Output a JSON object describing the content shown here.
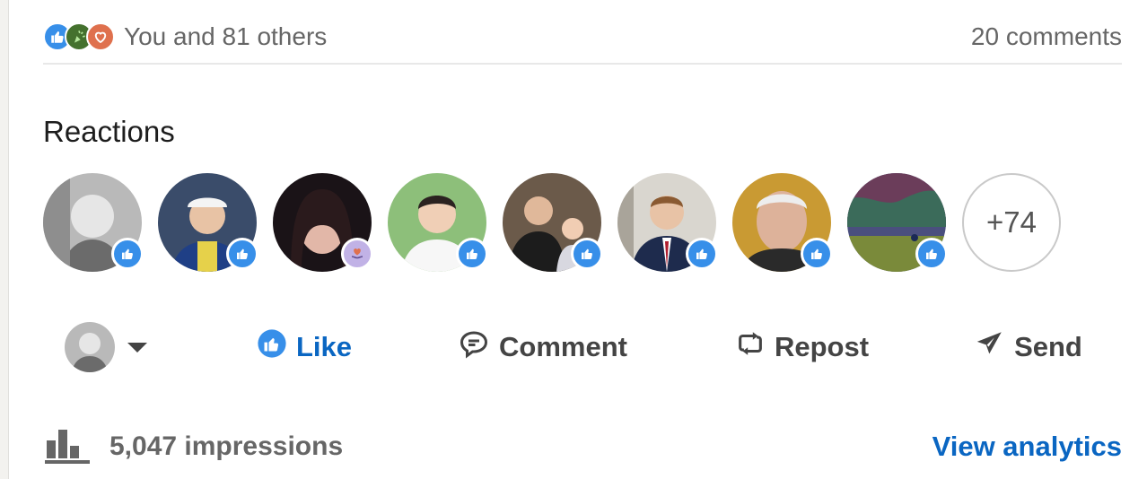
{
  "social_counts": {
    "reactions_text": "You and 81 others",
    "comments_text": "20 comments",
    "reaction_types": [
      "like",
      "celebrate",
      "love"
    ]
  },
  "reactions": {
    "title": "Reactions",
    "reactors": [
      {
        "reaction": "like"
      },
      {
        "reaction": "like"
      },
      {
        "reaction": "love"
      },
      {
        "reaction": "like"
      },
      {
        "reaction": "like"
      },
      {
        "reaction": "like"
      },
      {
        "reaction": "like"
      },
      {
        "reaction": "like"
      }
    ],
    "more_count": "+74"
  },
  "actions": {
    "like": "Like",
    "comment": "Comment",
    "repost": "Repost",
    "send": "Send"
  },
  "analytics": {
    "impressions": "5,047 impressions",
    "view_link": "View analytics"
  },
  "colors": {
    "like_blue": "#378fe9",
    "brand_blue": "#0a66c2",
    "love": "#df704d",
    "celebrate": "#44712e"
  }
}
